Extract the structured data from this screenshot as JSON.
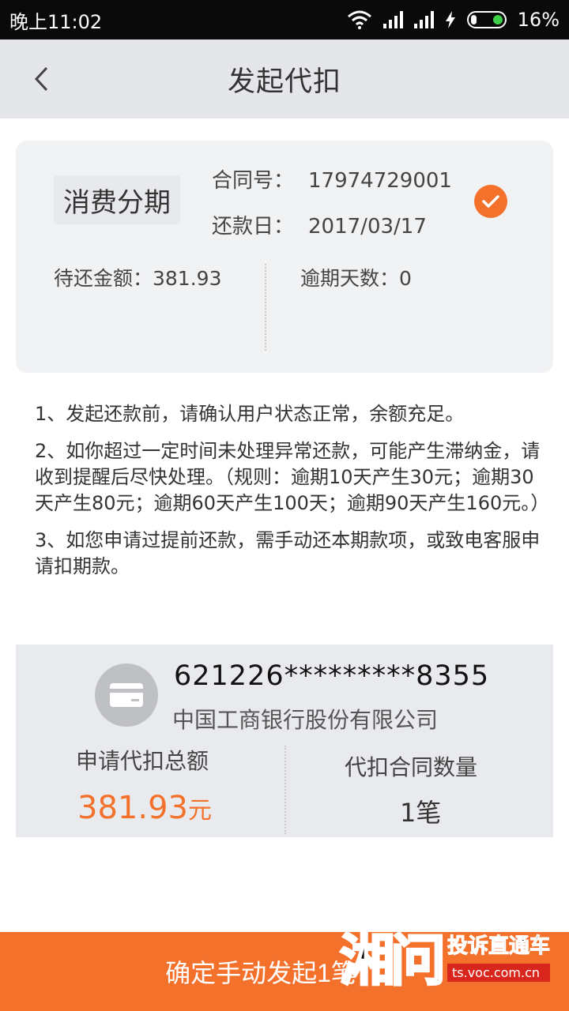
{
  "status_bar": {
    "time": "晚上11:02",
    "battery": "16%"
  },
  "nav": {
    "title": "发起代扣"
  },
  "contract": {
    "product": "消费分期",
    "contract_label": "合同号：",
    "contract_no": "17974729001",
    "repay_label": "还款日：",
    "repay_date": "2017/03/17",
    "due_amount": "待还金额：381.93",
    "overdue_days": "逾期天数：0",
    "selected": true
  },
  "notes": [
    "1、发起还款前，请确认用户状态正常，余额充足。",
    "2、如你超过一定时间未处理异常还款，可能产生滞纳金，请收到提醒后尽快处理。（规则：逾期10天产生30元；逾期30天产生80元；逾期60天产生100天；逾期90天产生160元。）",
    "3、如您申请过提前还款，需手动还本期款项，或致电客服申请扣期款。"
  ],
  "bank": {
    "card_no": "621226*********8355",
    "bank_name": "中国工商银行股份有限公司",
    "total_label": "申请代扣总额",
    "total_amount": "381.93",
    "total_unit": "元",
    "count_label": "代扣合同数量",
    "count_value": "1笔"
  },
  "confirm_button": {
    "label": "确定手动发起1笔"
  },
  "watermark": {
    "logo": "湘问",
    "title": "投诉直通车",
    "url": "ts.voc.com.cn"
  },
  "colors": {
    "accent": "#f4712b",
    "nav_bg": "#e5e6ea"
  }
}
